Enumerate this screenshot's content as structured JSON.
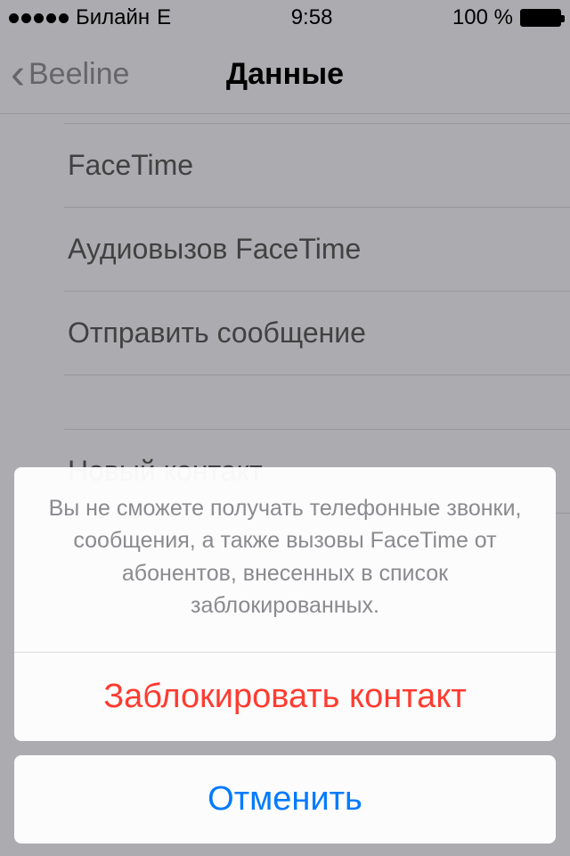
{
  "statusBar": {
    "carrier": "Билайн",
    "networkType": "E",
    "time": "9:58",
    "batteryText": "100 %"
  },
  "nav": {
    "backLabel": "Beeline",
    "title": "Данные"
  },
  "list": {
    "rows": [
      "FaceTime",
      "Аудиовызов FaceTime",
      "Отправить сообщение"
    ],
    "section2": [
      "Новый контакт"
    ]
  },
  "actionSheet": {
    "message": "Вы не сможете получать телефонные звонки, сообщения, а также вызовы FaceTime от абонентов, внесенных в список заблокированных.",
    "destructive": "Заблокировать контакт",
    "cancel": "Отменить"
  }
}
